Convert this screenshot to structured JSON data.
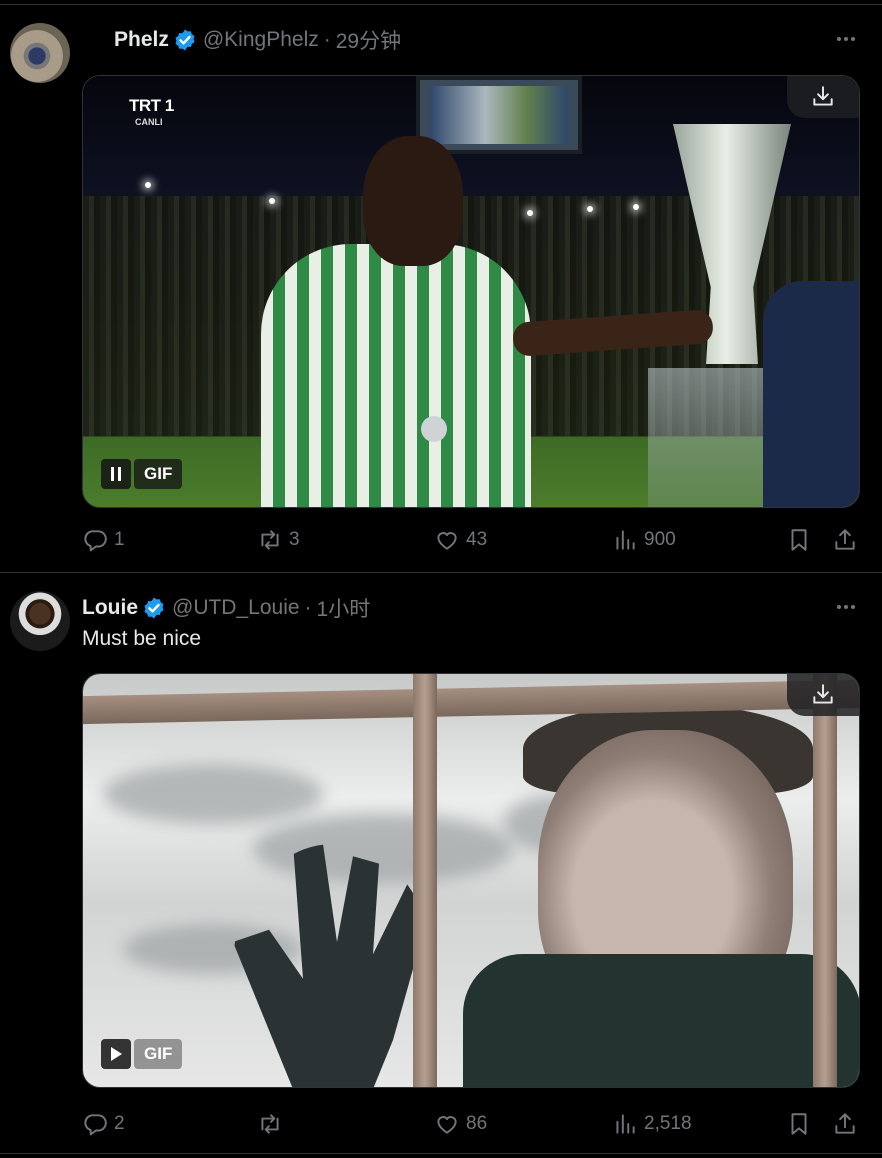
{
  "colors": {
    "background": "#000000",
    "text_primary": "#e7e9ea",
    "text_secondary": "#71767b",
    "verified_badge": "#1d9bf0",
    "divider": "#2f3336"
  },
  "tweets": [
    {
      "display_name": "Phelz",
      "handle": "@KingPhelz",
      "separator": "·",
      "time": "29分钟",
      "text": "",
      "media": {
        "type": "GIF",
        "gif_label": "GIF",
        "state": "playing",
        "control_icon": "pause-icon",
        "watermark": "TRT 1",
        "watermark_sub": "CANLI"
      },
      "stats": {
        "replies": "1",
        "retweets": "3",
        "likes": "43",
        "views": "900"
      }
    },
    {
      "display_name": "Louie",
      "handle": "@UTD_Louie",
      "separator": "·",
      "time": "1小时",
      "text": "Must be nice",
      "media": {
        "type": "GIF",
        "gif_label": "GIF",
        "state": "paused",
        "control_icon": "play-icon"
      },
      "stats": {
        "replies": "2",
        "retweets": "",
        "likes": "86",
        "views": "2,518"
      }
    }
  ]
}
